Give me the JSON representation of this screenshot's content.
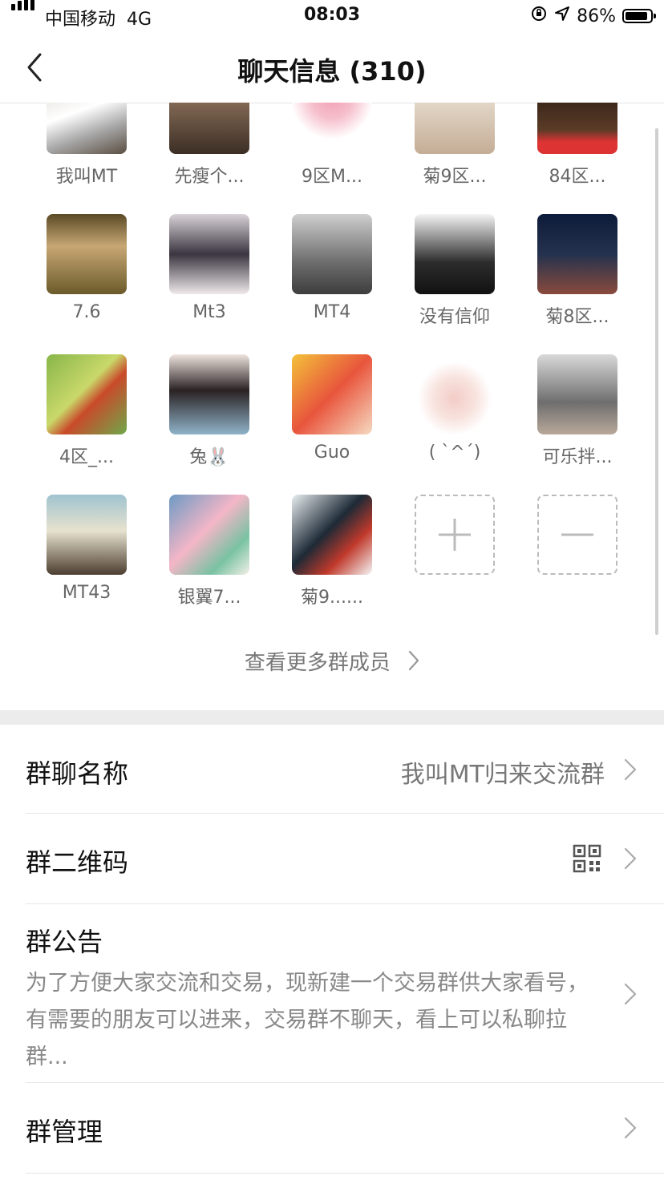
{
  "status_bar": {
    "carrier": "中国移动",
    "network": "4G",
    "time": "08:03",
    "battery": "86%"
  },
  "nav": {
    "title": "聊天信息 (310)"
  },
  "members": [
    {
      "name": "我叫MT"
    },
    {
      "name": "先瘦个..."
    },
    {
      "name": "9区M..."
    },
    {
      "name": "菊9区..."
    },
    {
      "name": "84区..."
    },
    {
      "name": "7.6"
    },
    {
      "name": "Mt3"
    },
    {
      "name": "MT4"
    },
    {
      "name": "没有信仰"
    },
    {
      "name": "菊8区..."
    },
    {
      "name": "4区_..."
    },
    {
      "name": "兔🐰"
    },
    {
      "name": "Guo"
    },
    {
      "name": "( `^´)"
    },
    {
      "name": "可乐拌..."
    },
    {
      "name": "MT43"
    },
    {
      "name": "银翼7..."
    },
    {
      "name": "菊9......"
    }
  ],
  "actions": {
    "add": "+",
    "remove": "—"
  },
  "more_members": "查看更多群成员",
  "settings": {
    "group_name": {
      "label": "群聊名称",
      "value": "我叫MT归来交流群"
    },
    "qr_code": {
      "label": "群二维码"
    },
    "announcement": {
      "label": "群公告",
      "text": "为了方便大家交流和交易，现新建一个交易群供大家看号，有需要的朋友可以进来，交易群不聊天，看上可以私聊拉群..."
    },
    "manage": {
      "label": "群管理"
    }
  }
}
